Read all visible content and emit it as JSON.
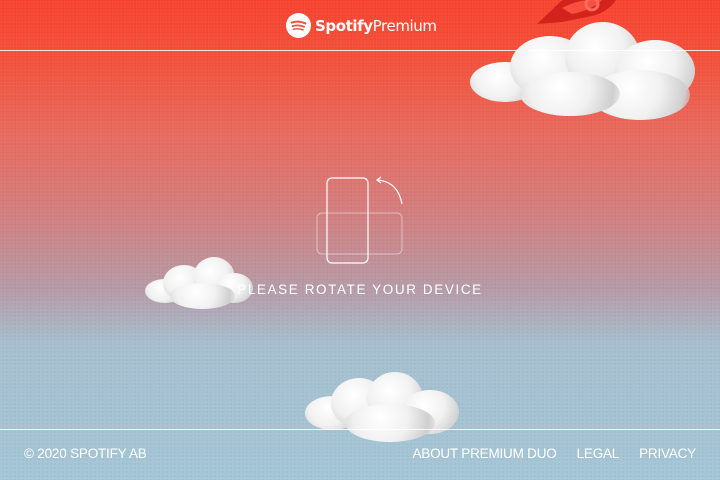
{
  "header": {
    "logo_brand": "Spotify",
    "logo_product": "Premium",
    "logo_icon": "spotify-logo-icon"
  },
  "main": {
    "rotate_icon": "rotate-device-icon",
    "message": "PLEASE ROTATE YOUR DEVICE"
  },
  "footer": {
    "copyright": "© 2020 SPOTIFY AB",
    "links": [
      {
        "label": "ABOUT PREMIUM DUO"
      },
      {
        "label": "LEGAL"
      },
      {
        "label": "PRIVACY"
      }
    ]
  },
  "colors": {
    "gradient_top": "#f8432f",
    "gradient_bottom": "#a3c6d6",
    "text": "#ffffff"
  }
}
